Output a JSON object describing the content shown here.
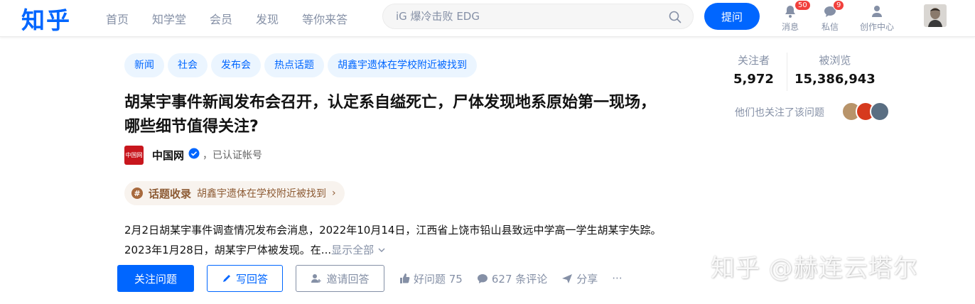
{
  "header": {
    "logo": "知乎",
    "nav": [
      "首页",
      "知学堂",
      "会员",
      "发现",
      "等你来答"
    ],
    "search_placeholder": "iG 爆冷击败 EDG",
    "ask_label": "提问",
    "messages": {
      "label": "消息",
      "badge": "50"
    },
    "private_msg": {
      "label": "私信",
      "badge": "9"
    },
    "creator_center": "创作中心"
  },
  "question": {
    "tags": [
      "新闻",
      "社会",
      "发布会",
      "热点话题",
      "胡鑫宇遗体在学校附近被找到"
    ],
    "title": "胡某宇事件新闻发布会召开，认定系自缢死亡，尸体发现地系原始第一现场，哪些细节值得关注?",
    "author": {
      "name": "中国网",
      "verified_text": "，已认证帐号",
      "logo_text": "中国网"
    },
    "collection": {
      "label": "话题收录",
      "topic": "胡鑫宇遗体在学校附近被找到"
    },
    "excerpt": "2月2日胡某宇事件调查情况发布会消息，2022年10月14日，江西省上饶市铅山县致远中学高一学生胡某宇失踪。2023年1月28日，胡某宇尸体被发现。在...",
    "show_all": "显示全部",
    "actions": {
      "follow": "关注问题",
      "answer": "写回答",
      "invite": "邀请回答",
      "good": "好问题 75",
      "comments": "627 条评论",
      "share": "分享",
      "more": "···"
    }
  },
  "sidebar": {
    "followers_label": "关注者",
    "followers_value": "5,972",
    "views_label": "被浏览",
    "views_value": "15,386,943",
    "also_follow": "他们也关注了该问题"
  },
  "watermark": "知乎 @赫连云塔尔",
  "colors": {
    "brand": "#0066ff",
    "badge": "#f1403c",
    "muted": "#8590a6",
    "collect_bg": "#f8f3ee",
    "collect_fg": "#8d5b34"
  }
}
